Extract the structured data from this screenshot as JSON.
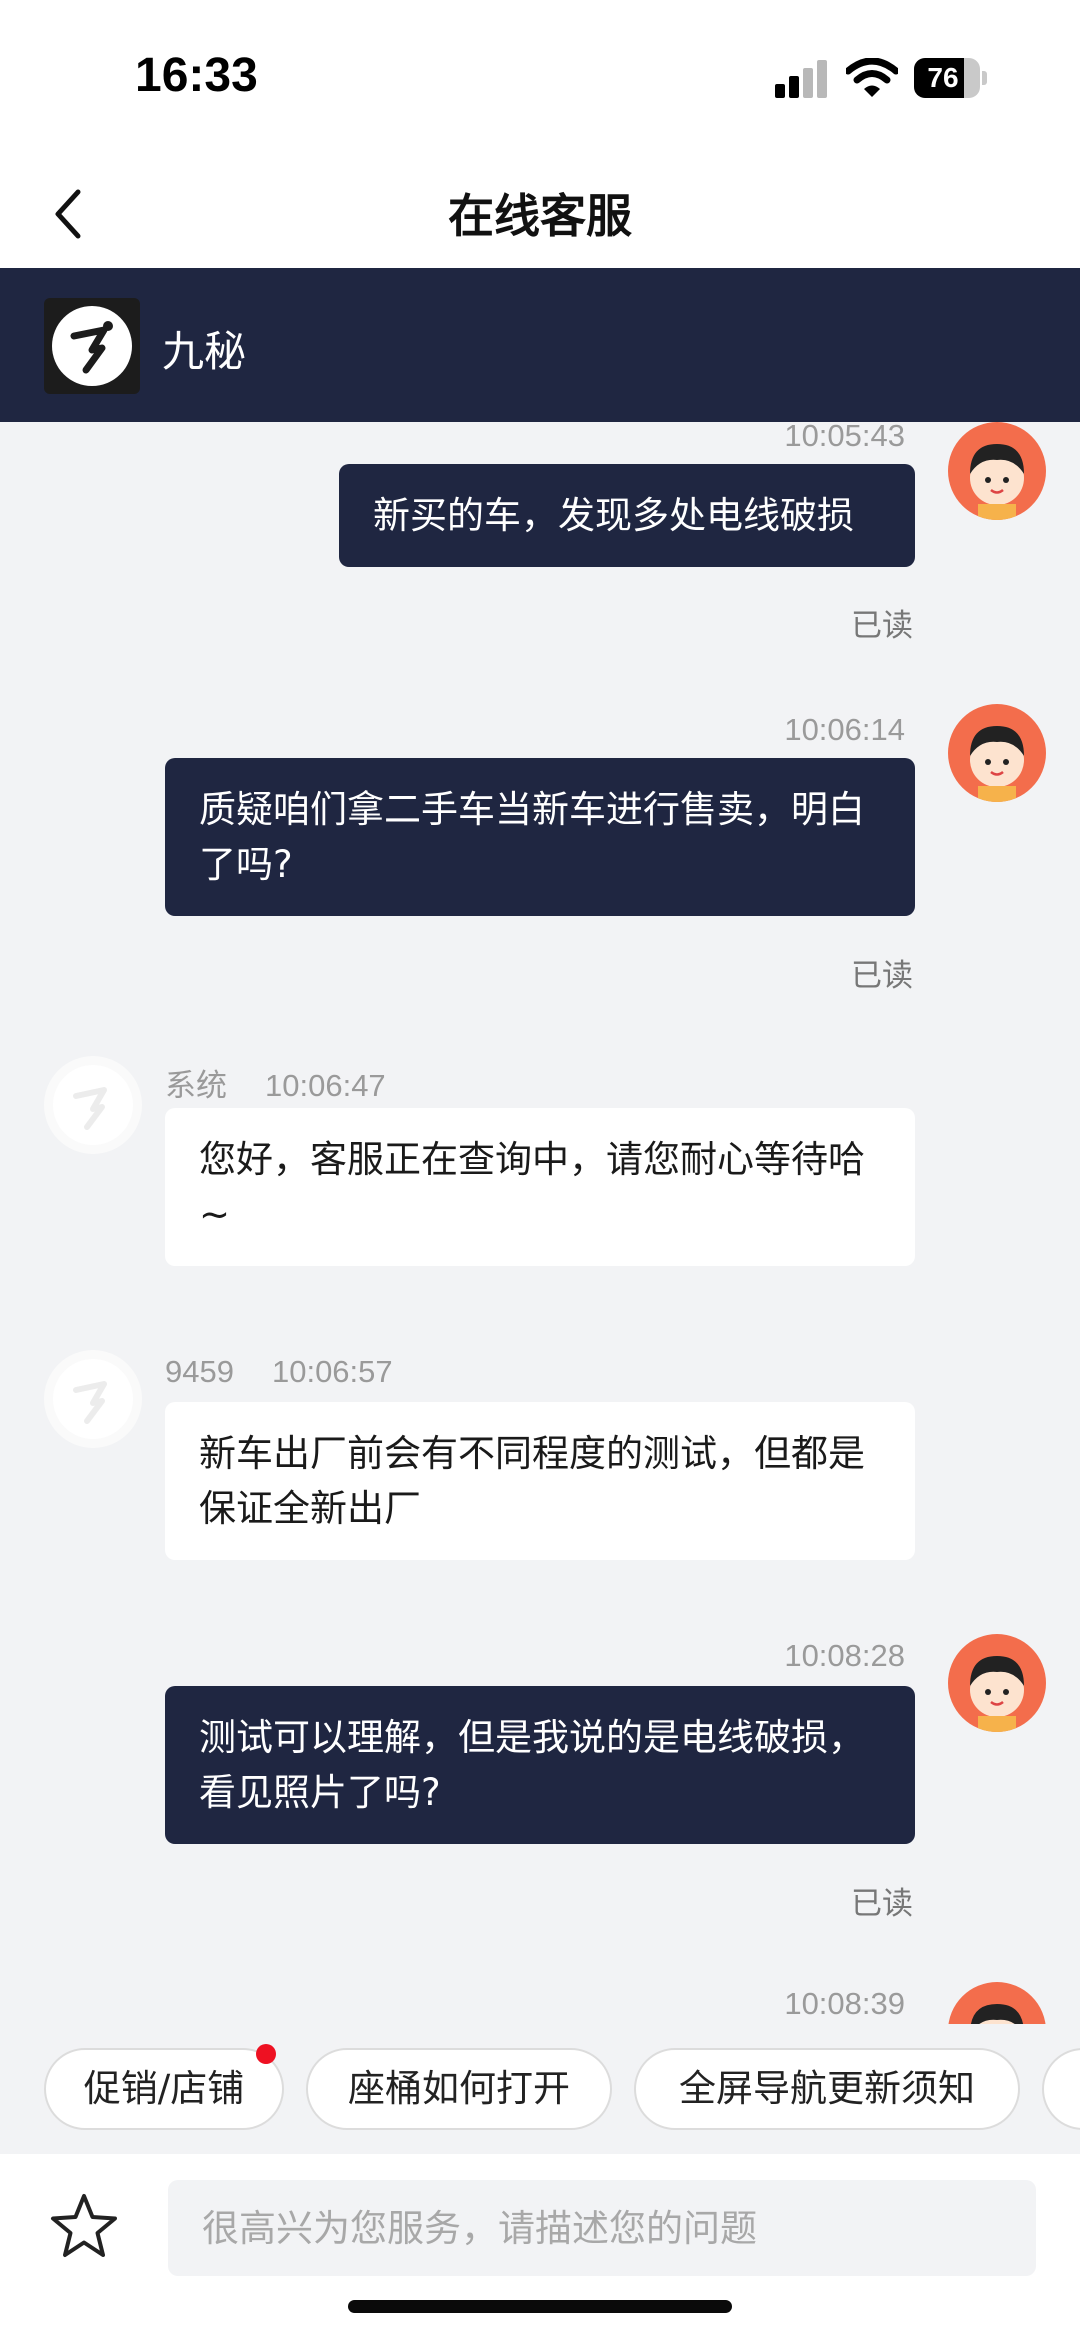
{
  "status_bar": {
    "time": "16:33",
    "battery": "76",
    "battery_level": 0.76
  },
  "nav": {
    "title": "在线客服"
  },
  "agent": {
    "name": "九秘"
  },
  "messages": [
    {
      "side": "user",
      "time": "10:05:43",
      "text": "新买的车，发现多处电线破损",
      "status": "已读"
    },
    {
      "side": "user",
      "time": "10:06:14",
      "text": "质疑咱们拿二手车当新车进行售卖，明白了吗?",
      "status": "已读"
    },
    {
      "side": "agent",
      "sender": "系统",
      "time": "10:06:47",
      "text": "您好，客服正在查询中，请您耐心等待哈~"
    },
    {
      "side": "agent",
      "sender": "9459",
      "time": "10:06:57",
      "text": "新车出厂前会有不同程度的测试，但都是保证全新出厂"
    },
    {
      "side": "user",
      "time": "10:08:28",
      "text": "测试可以理解，但是我说的是电线破损，看见照片了吗?",
      "status": "已读"
    },
    {
      "side": "user",
      "time": "10:08:39"
    }
  ],
  "quick_replies": [
    {
      "label": "促销/店铺",
      "badge": true
    },
    {
      "label": "座桶如何打开"
    },
    {
      "label": "全屏导航更新须知"
    }
  ],
  "input": {
    "placeholder": "很高兴为您服务，请描述您的问题"
  },
  "colors": {
    "header": "#1f2641",
    "user_bubble": "#1f2641",
    "user_avatar": "#f36d4c",
    "badge": "#ee1122"
  }
}
